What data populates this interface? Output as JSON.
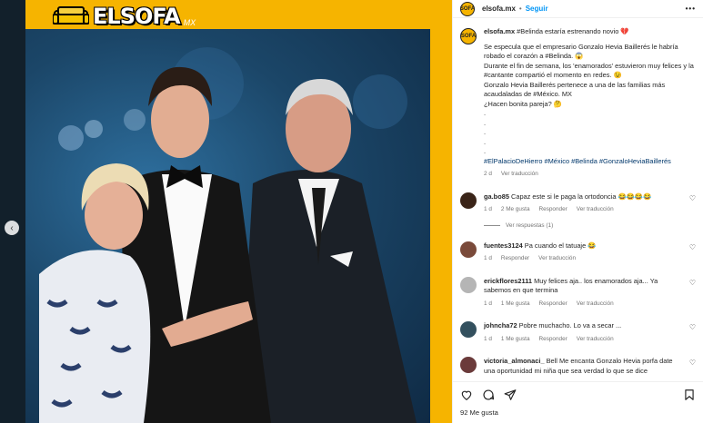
{
  "brand": {
    "logo_text": "ELSOFA",
    "logo_suffix": "MX",
    "accent": "#f6b400"
  },
  "header": {
    "username": "elsofa.mx",
    "dot": "•",
    "follow": "Seguir",
    "more": "•••"
  },
  "caption": {
    "username": "elsofa.mx",
    "lines": [
      "#Belinda estaría estrenando novio 💔",
      "Se especula que el empresario Gonzalo Hevia Baillerés le habría robado el corazón a #Belinda. 😱",
      "Durante el fin de semana, los 'enamorados' estuvieron muy felices y la #cantante compartió el momento en redes. 😉",
      "Gonzalo Hevia Baillerés pertenece a una de las familias más acaudaladas de #México. MX",
      "¿Hacen bonita pareja? 🤔",
      ".",
      ".",
      ".",
      ".",
      ".",
      "#ElPalacioDeHierro #México #Belinda #GonzaloHeviaBaillerés"
    ],
    "time": "2 d",
    "translate": "Ver traducción"
  },
  "comments": [
    {
      "user": "ga.bo85",
      "text": "Capaz este si le paga la ortodoncia 😂😂😂😂",
      "time": "1 d",
      "likes": "2 Me gusta",
      "reply": "Responder",
      "translate": "Ver traducción",
      "replies": "Ver respuestas (1)"
    },
    {
      "user": "fuentes3124",
      "text": "Pa cuando el tatuaje 😂",
      "time": "1 d",
      "likes": "",
      "reply": "Responder",
      "translate": "Ver traducción"
    },
    {
      "user": "erickflores2111",
      "text": "Muy felices aja.. los enamorados aja... Ya sabemos en que termina",
      "time": "1 d",
      "likes": "1 Me gusta",
      "reply": "Responder",
      "translate": "Ver traducción"
    },
    {
      "user": "johncha72",
      "text": "Pobre muchacho. Lo va a secar ...",
      "time": "1 d",
      "likes": "1 Me gusta",
      "reply": "Responder",
      "translate": "Ver traducción"
    },
    {
      "user": "victoria_almonaci_",
      "text": "Bell Me encanta Gonzalo Hevia porfa date una oportunidad mi niña que sea verdad lo que se dice",
      "time": "",
      "likes": "",
      "reply": "",
      "translate": ""
    }
  ],
  "footer": {
    "likes": "92 Me gusta"
  },
  "icons": [
    "heart-icon",
    "comment-icon",
    "share-icon",
    "bookmark-icon",
    "chevron-left-icon"
  ]
}
